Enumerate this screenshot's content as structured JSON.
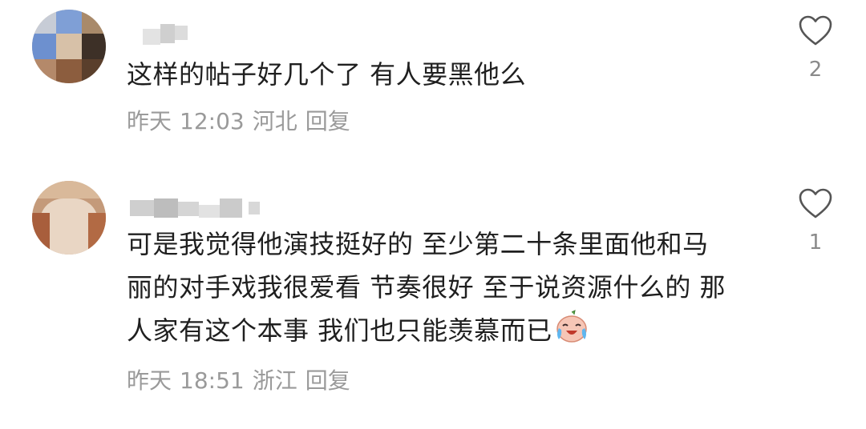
{
  "comments": [
    {
      "text": "这样的帖子好几个了 有人要黑他么",
      "date": "昨天",
      "time": "12:03",
      "location": "河北",
      "reply_label": "回复",
      "like_count": "2",
      "like_icon": "heart-outline-icon"
    },
    {
      "text_lines": [
        "可是我觉得他演技挺好的 至少第二十条里面他和马",
        "丽的对手戏我很爱看 节奏很好 至于说资源什么的 那",
        "人家有这个本事 我们也只能羡慕而已"
      ],
      "emoji": "crying-laughing-emoji",
      "date": "昨天",
      "time": "18:51",
      "location": "浙江",
      "reply_label": "回复",
      "like_count": "1",
      "like_icon": "heart-outline-icon"
    }
  ]
}
